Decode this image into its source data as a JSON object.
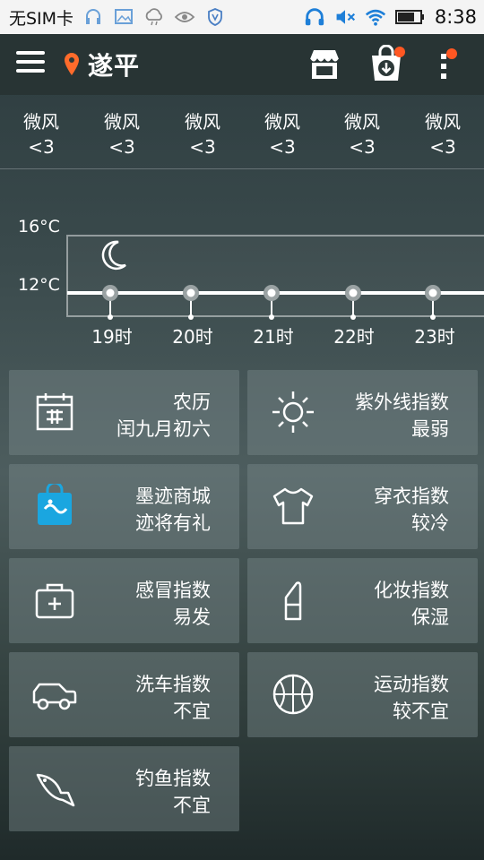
{
  "status_bar": {
    "carrier": "无SIM卡",
    "time": "8:38"
  },
  "app_bar": {
    "city": "遂平"
  },
  "wind": [
    {
      "label": "微风",
      "value": "<3"
    },
    {
      "label": "微风",
      "value": "<3"
    },
    {
      "label": "微风",
      "value": "<3"
    },
    {
      "label": "微风",
      "value": "<3"
    },
    {
      "label": "微风",
      "value": "<3"
    },
    {
      "label": "微风",
      "value": "<3"
    }
  ],
  "chart": {
    "y_ticks": [
      "16°C",
      "12°C"
    ],
    "hours": [
      "19时",
      "20时",
      "21时",
      "22时",
      "23时"
    ],
    "temps": [
      12,
      12,
      12,
      12,
      12
    ]
  },
  "cards": [
    {
      "icon": "calendar-icon",
      "title": "农历",
      "value": "闰九月初六"
    },
    {
      "icon": "sun-icon",
      "title": "紫外线指数",
      "value": "最弱"
    },
    {
      "icon": "shopping-bag-icon",
      "title": "墨迹商城",
      "value": "迹将有礼"
    },
    {
      "icon": "tshirt-icon",
      "title": "穿衣指数",
      "value": "较冷"
    },
    {
      "icon": "first-aid-kit-icon",
      "title": "感冒指数",
      "value": "易发"
    },
    {
      "icon": "lipstick-icon",
      "title": "化妆指数",
      "value": "保湿"
    },
    {
      "icon": "car-icon",
      "title": "洗车指数",
      "value": "不宜"
    },
    {
      "icon": "basketball-icon",
      "title": "运动指数",
      "value": "较不宜"
    },
    {
      "icon": "fish-icon",
      "title": "钓鱼指数",
      "value": "不宜"
    }
  ],
  "colors": {
    "accent": "#ff5722",
    "location_pin": "#ff6b2b",
    "shop_bag": "#1aa6e0"
  }
}
